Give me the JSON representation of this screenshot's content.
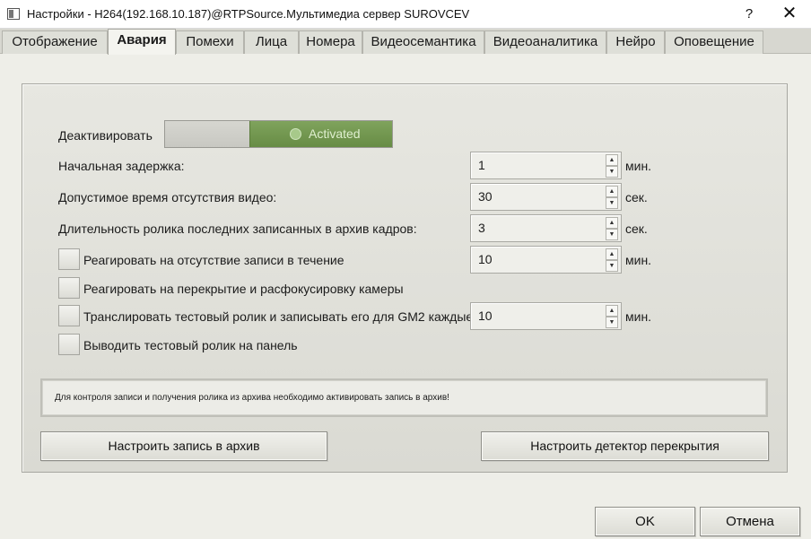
{
  "window": {
    "title": "Настройки - H264(192.168.10.187)@RTPSource.Мультимедиа сервер SUROVCEV",
    "help_label": "?",
    "close_label": "✕"
  },
  "tabs": [
    {
      "label": "Отображение",
      "active": false
    },
    {
      "label": "Авария",
      "active": true
    },
    {
      "label": "Помехи",
      "active": false
    },
    {
      "label": "Лица",
      "active": false
    },
    {
      "label": "Номера",
      "active": false
    },
    {
      "label": "Видеосемантика",
      "active": false
    },
    {
      "label": "Видеоаналитика",
      "active": false
    },
    {
      "label": "Нейро",
      "active": false
    },
    {
      "label": "Оповещение",
      "active": false
    }
  ],
  "deactivate": {
    "label": "Деактивировать",
    "state_label": "Activated",
    "active": true
  },
  "fields": [
    {
      "label": "Начальная задержка:",
      "value": "1",
      "unit": "мин."
    },
    {
      "label": "Допустимое время отсутствия видео:",
      "value": "30",
      "unit": "сек."
    },
    {
      "label": "Длительность ролика последних записанных в архив кадров:",
      "value": "3",
      "unit": "сек."
    }
  ],
  "checkboxes": [
    {
      "label": "Реагировать на отсутствие записи в течение",
      "checked": false,
      "value": "10",
      "unit": "мин."
    },
    {
      "label": "Реагировать на перекрытие и расфокусировку камеры",
      "checked": false
    },
    {
      "label": "Транслировать тестовый ролик и записывать его для GM2 каждые",
      "checked": false,
      "value": "10",
      "unit": "мин."
    },
    {
      "label": "Выводить тестовый ролик на панель",
      "checked": false
    }
  ],
  "info": {
    "text": "Для контроля записи и получения ролика из архива необходимо активировать запись в архив!"
  },
  "buttons": {
    "archive": "Настроить запись в архив",
    "overlap": "Настроить детектор перекрытия",
    "ok": "OK",
    "cancel": "Отмена"
  },
  "colors": {
    "toggle_on": "#6f9450",
    "background": "#eeeee8"
  }
}
